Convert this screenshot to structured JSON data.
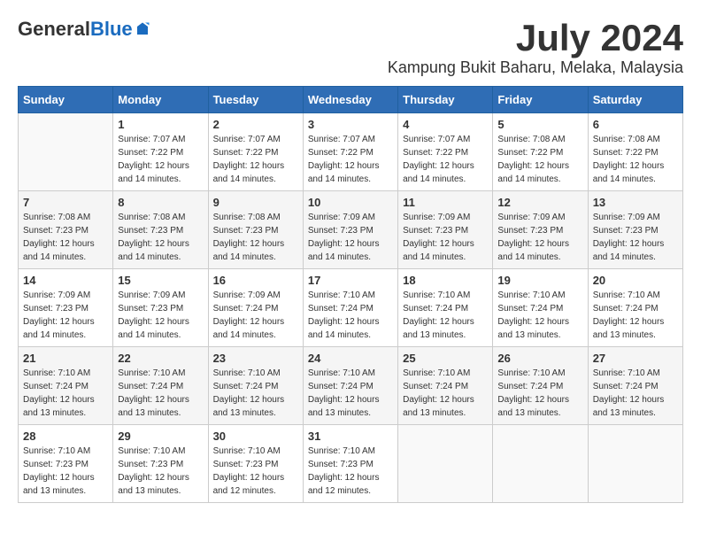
{
  "header": {
    "logo": {
      "general": "General",
      "blue": "Blue"
    },
    "month": "July 2024",
    "location": "Kampung Bukit Baharu, Melaka, Malaysia"
  },
  "weekdays": [
    "Sunday",
    "Monday",
    "Tuesday",
    "Wednesday",
    "Thursday",
    "Friday",
    "Saturday"
  ],
  "weeks": [
    [
      {
        "day": "",
        "sunrise": "",
        "sunset": "",
        "daylight": ""
      },
      {
        "day": "1",
        "sunrise": "Sunrise: 7:07 AM",
        "sunset": "Sunset: 7:22 PM",
        "daylight": "Daylight: 12 hours and 14 minutes."
      },
      {
        "day": "2",
        "sunrise": "Sunrise: 7:07 AM",
        "sunset": "Sunset: 7:22 PM",
        "daylight": "Daylight: 12 hours and 14 minutes."
      },
      {
        "day": "3",
        "sunrise": "Sunrise: 7:07 AM",
        "sunset": "Sunset: 7:22 PM",
        "daylight": "Daylight: 12 hours and 14 minutes."
      },
      {
        "day": "4",
        "sunrise": "Sunrise: 7:07 AM",
        "sunset": "Sunset: 7:22 PM",
        "daylight": "Daylight: 12 hours and 14 minutes."
      },
      {
        "day": "5",
        "sunrise": "Sunrise: 7:08 AM",
        "sunset": "Sunset: 7:22 PM",
        "daylight": "Daylight: 12 hours and 14 minutes."
      },
      {
        "day": "6",
        "sunrise": "Sunrise: 7:08 AM",
        "sunset": "Sunset: 7:22 PM",
        "daylight": "Daylight: 12 hours and 14 minutes."
      }
    ],
    [
      {
        "day": "7",
        "sunrise": "Sunrise: 7:08 AM",
        "sunset": "Sunset: 7:23 PM",
        "daylight": "Daylight: 12 hours and 14 minutes."
      },
      {
        "day": "8",
        "sunrise": "Sunrise: 7:08 AM",
        "sunset": "Sunset: 7:23 PM",
        "daylight": "Daylight: 12 hours and 14 minutes."
      },
      {
        "day": "9",
        "sunrise": "Sunrise: 7:08 AM",
        "sunset": "Sunset: 7:23 PM",
        "daylight": "Daylight: 12 hours and 14 minutes."
      },
      {
        "day": "10",
        "sunrise": "Sunrise: 7:09 AM",
        "sunset": "Sunset: 7:23 PM",
        "daylight": "Daylight: 12 hours and 14 minutes."
      },
      {
        "day": "11",
        "sunrise": "Sunrise: 7:09 AM",
        "sunset": "Sunset: 7:23 PM",
        "daylight": "Daylight: 12 hours and 14 minutes."
      },
      {
        "day": "12",
        "sunrise": "Sunrise: 7:09 AM",
        "sunset": "Sunset: 7:23 PM",
        "daylight": "Daylight: 12 hours and 14 minutes."
      },
      {
        "day": "13",
        "sunrise": "Sunrise: 7:09 AM",
        "sunset": "Sunset: 7:23 PM",
        "daylight": "Daylight: 12 hours and 14 minutes."
      }
    ],
    [
      {
        "day": "14",
        "sunrise": "Sunrise: 7:09 AM",
        "sunset": "Sunset: 7:23 PM",
        "daylight": "Daylight: 12 hours and 14 minutes."
      },
      {
        "day": "15",
        "sunrise": "Sunrise: 7:09 AM",
        "sunset": "Sunset: 7:23 PM",
        "daylight": "Daylight: 12 hours and 14 minutes."
      },
      {
        "day": "16",
        "sunrise": "Sunrise: 7:09 AM",
        "sunset": "Sunset: 7:24 PM",
        "daylight": "Daylight: 12 hours and 14 minutes."
      },
      {
        "day": "17",
        "sunrise": "Sunrise: 7:10 AM",
        "sunset": "Sunset: 7:24 PM",
        "daylight": "Daylight: 12 hours and 14 minutes."
      },
      {
        "day": "18",
        "sunrise": "Sunrise: 7:10 AM",
        "sunset": "Sunset: 7:24 PM",
        "daylight": "Daylight: 12 hours and 13 minutes."
      },
      {
        "day": "19",
        "sunrise": "Sunrise: 7:10 AM",
        "sunset": "Sunset: 7:24 PM",
        "daylight": "Daylight: 12 hours and 13 minutes."
      },
      {
        "day": "20",
        "sunrise": "Sunrise: 7:10 AM",
        "sunset": "Sunset: 7:24 PM",
        "daylight": "Daylight: 12 hours and 13 minutes."
      }
    ],
    [
      {
        "day": "21",
        "sunrise": "Sunrise: 7:10 AM",
        "sunset": "Sunset: 7:24 PM",
        "daylight": "Daylight: 12 hours and 13 minutes."
      },
      {
        "day": "22",
        "sunrise": "Sunrise: 7:10 AM",
        "sunset": "Sunset: 7:24 PM",
        "daylight": "Daylight: 12 hours and 13 minutes."
      },
      {
        "day": "23",
        "sunrise": "Sunrise: 7:10 AM",
        "sunset": "Sunset: 7:24 PM",
        "daylight": "Daylight: 12 hours and 13 minutes."
      },
      {
        "day": "24",
        "sunrise": "Sunrise: 7:10 AM",
        "sunset": "Sunset: 7:24 PM",
        "daylight": "Daylight: 12 hours and 13 minutes."
      },
      {
        "day": "25",
        "sunrise": "Sunrise: 7:10 AM",
        "sunset": "Sunset: 7:24 PM",
        "daylight": "Daylight: 12 hours and 13 minutes."
      },
      {
        "day": "26",
        "sunrise": "Sunrise: 7:10 AM",
        "sunset": "Sunset: 7:24 PM",
        "daylight": "Daylight: 12 hours and 13 minutes."
      },
      {
        "day": "27",
        "sunrise": "Sunrise: 7:10 AM",
        "sunset": "Sunset: 7:24 PM",
        "daylight": "Daylight: 12 hours and 13 minutes."
      }
    ],
    [
      {
        "day": "28",
        "sunrise": "Sunrise: 7:10 AM",
        "sunset": "Sunset: 7:23 PM",
        "daylight": "Daylight: 12 hours and 13 minutes."
      },
      {
        "day": "29",
        "sunrise": "Sunrise: 7:10 AM",
        "sunset": "Sunset: 7:23 PM",
        "daylight": "Daylight: 12 hours and 13 minutes."
      },
      {
        "day": "30",
        "sunrise": "Sunrise: 7:10 AM",
        "sunset": "Sunset: 7:23 PM",
        "daylight": "Daylight: 12 hours and 12 minutes."
      },
      {
        "day": "31",
        "sunrise": "Sunrise: 7:10 AM",
        "sunset": "Sunset: 7:23 PM",
        "daylight": "Daylight: 12 hours and 12 minutes."
      },
      {
        "day": "",
        "sunrise": "",
        "sunset": "",
        "daylight": ""
      },
      {
        "day": "",
        "sunrise": "",
        "sunset": "",
        "daylight": ""
      },
      {
        "day": "",
        "sunrise": "",
        "sunset": "",
        "daylight": ""
      }
    ]
  ]
}
